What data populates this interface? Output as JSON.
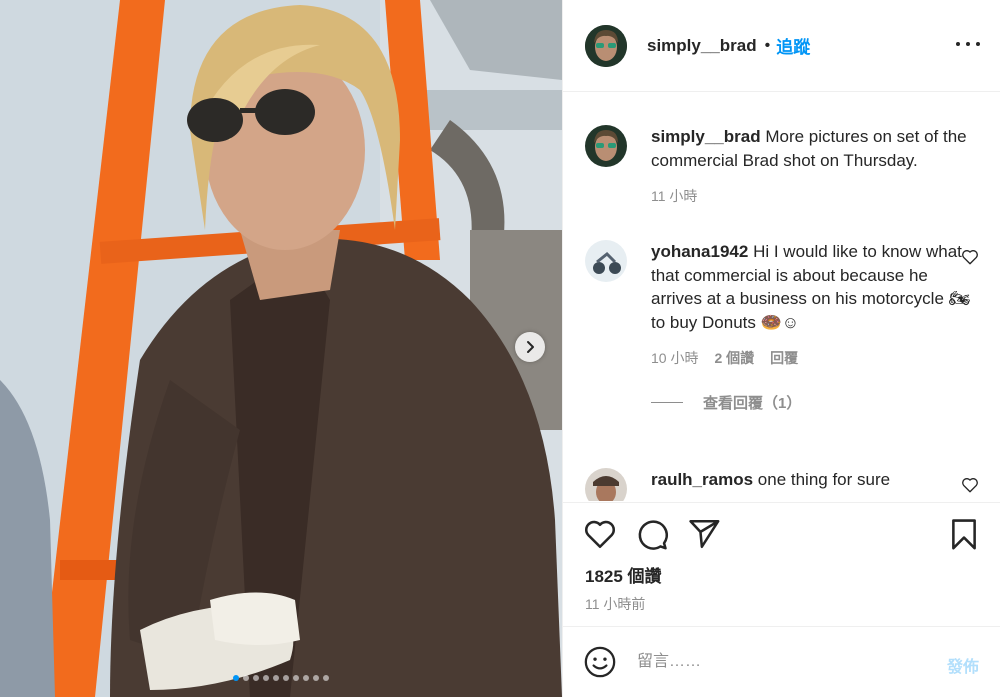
{
  "header": {
    "username": "simply__brad",
    "separator": "•",
    "follow_label": "追蹤"
  },
  "caption": {
    "username": "simply__brad",
    "text": "More pictures on set of the commercial Brad shot on Thursday.",
    "time": "11 小時"
  },
  "comments": [
    {
      "username": "yohana1942",
      "text": "Hi I would like to know what that commercial is about because he arrives at a business on his motorcycle 🏍 to buy Donuts 🍩☺",
      "time": "10 小時",
      "likes": "2 個讚",
      "reply_label": "回覆",
      "view_replies": "查看回覆（1）"
    },
    {
      "username": "raulh_ramos",
      "text": "one thing for sure"
    }
  ],
  "stats": {
    "likes": "1825 個讚",
    "posted": "11 小時前"
  },
  "compose": {
    "placeholder": "留言……",
    "post_label": "發佈"
  },
  "carousel": {
    "slide_count": 10,
    "active_index": 0
  },
  "icons": {
    "like": "heart-icon",
    "comment": "comment-bubble-icon",
    "share": "paper-plane-icon",
    "save": "bookmark-icon",
    "emoji": "smiley-icon",
    "more": "more-options-icon",
    "next": "chevron-right-icon"
  },
  "colors": {
    "accent": "#0095f6",
    "muted": "#8e8e8e",
    "post_disabled": "#b2dffc"
  }
}
